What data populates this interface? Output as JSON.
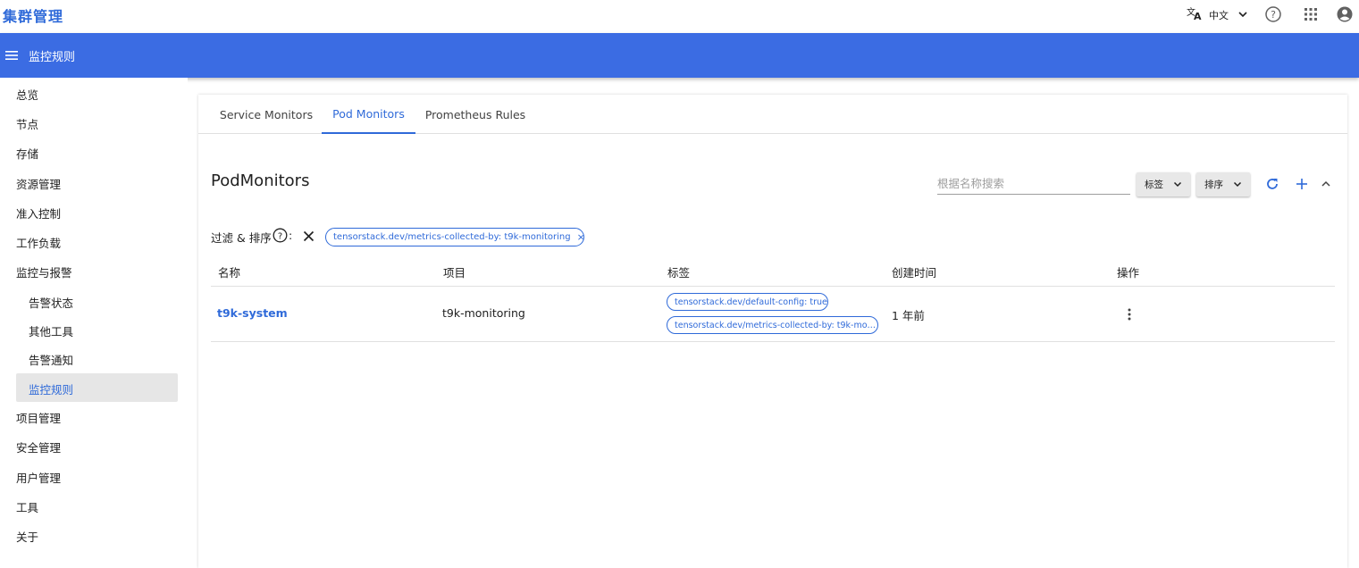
{
  "app": {
    "title": "集群管理"
  },
  "topbar": {
    "language": "中文"
  },
  "header": {
    "title": "监控规则"
  },
  "sidebar": {
    "items": [
      {
        "label": "总览"
      },
      {
        "label": "节点"
      },
      {
        "label": "存储"
      },
      {
        "label": "资源管理"
      },
      {
        "label": "准入控制"
      },
      {
        "label": "工作负载"
      },
      {
        "label": "监控与报警"
      },
      {
        "label": "告警状态"
      },
      {
        "label": "其他工具"
      },
      {
        "label": "告警通知"
      },
      {
        "label": "监控规则"
      },
      {
        "label": "项目管理"
      },
      {
        "label": "安全管理"
      },
      {
        "label": "用户管理"
      },
      {
        "label": "工具"
      },
      {
        "label": "关于"
      }
    ]
  },
  "tabs": [
    {
      "label": "Service Monitors"
    },
    {
      "label": "Pod Monitors"
    },
    {
      "label": "Prometheus Rules"
    }
  ],
  "main": {
    "title": "PodMonitors",
    "search_placeholder": "根据名称搜索",
    "label_select": "标签",
    "sort_select": "排序",
    "filter_label": "过滤 & 排序",
    "filter_colon": ":",
    "filter_chip": "tensorstack.dev/metrics-collected-by: t9k-monitoring",
    "filter_chip_close": "×"
  },
  "table": {
    "headers": [
      "名称",
      "项目",
      "标签",
      "创建时间",
      "操作"
    ],
    "rows": [
      {
        "name": "t9k-system",
        "project": "t9k-monitoring",
        "labels": [
          "tensorstack.dev/default-config: true",
          "tensorstack.dev/metrics-collected-by: t9k-mo…"
        ],
        "created": "1 年前"
      }
    ]
  },
  "colors": {
    "primary": "#3b6ce3",
    "link": "#2f6ad9"
  }
}
